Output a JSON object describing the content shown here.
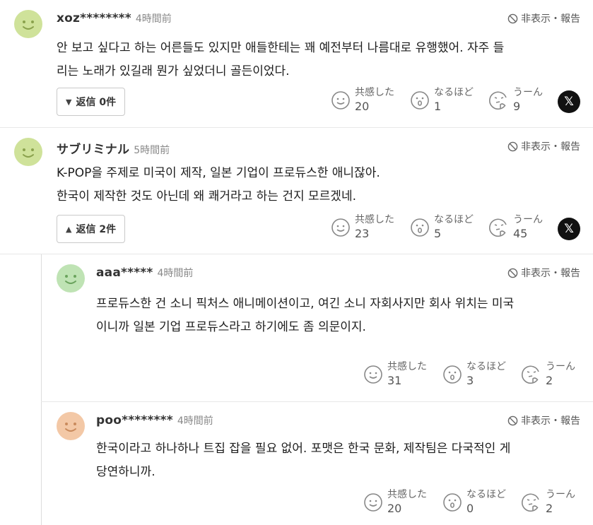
{
  "common": {
    "report_label": "非表示・報告",
    "reaction_labels": [
      "共感した",
      "なるほど",
      "うーん"
    ],
    "x_label": "𝕏"
  },
  "comments": [
    {
      "avatar_color": "#cfe29a",
      "user": "xoz********",
      "time": "4時間前",
      "text": "안 보고 싶다고 하는 어른들도 있지만 애들한테는 꽤 예전부터 나름대로 유행했어. 자주 들\n리는 노래가 있길래 뭔가 싶었더니 골든이었다.",
      "reply_label": "返信 0件",
      "reply_icon": "triangle-down",
      "counts": [
        "20",
        "1",
        "9"
      ]
    },
    {
      "avatar_color": "#cfe29a",
      "user": "サブリミナル",
      "time": "5時間前",
      "text": "K-POP을 주제로 미국이 제작, 일본 기업이 프로듀스한 애니잖아.\n한국이 제작한 것도 아닌데 왜 쾌거라고 하는 건지 모르겠네.",
      "reply_label": "返信 2件",
      "reply_icon": "triangle-up",
      "counts": [
        "23",
        "5",
        "45"
      ]
    },
    {
      "avatar_color": "#bfe3b4",
      "user": "aaa*****",
      "time": "4時間前",
      "text": "프로듀스한 건 소니 픽처스 애니메이션이고, 여긴 소니 자회사지만 회사 위치는 미국\n이니까 일본 기업 프로듀스라고 하기에도 좀 의문이지.",
      "counts": [
        "31",
        "3",
        "2"
      ]
    },
    {
      "avatar_color": "#f3c8a6",
      "user": "poo********",
      "time": "4時間前",
      "text": "한국이라고 하나하나 트집 잡을 필요 없어. 포맷은 한국 문화, 제작팀은 다국적인 게\n당연하니까.",
      "counts": [
        "20",
        "0",
        "2"
      ]
    }
  ]
}
